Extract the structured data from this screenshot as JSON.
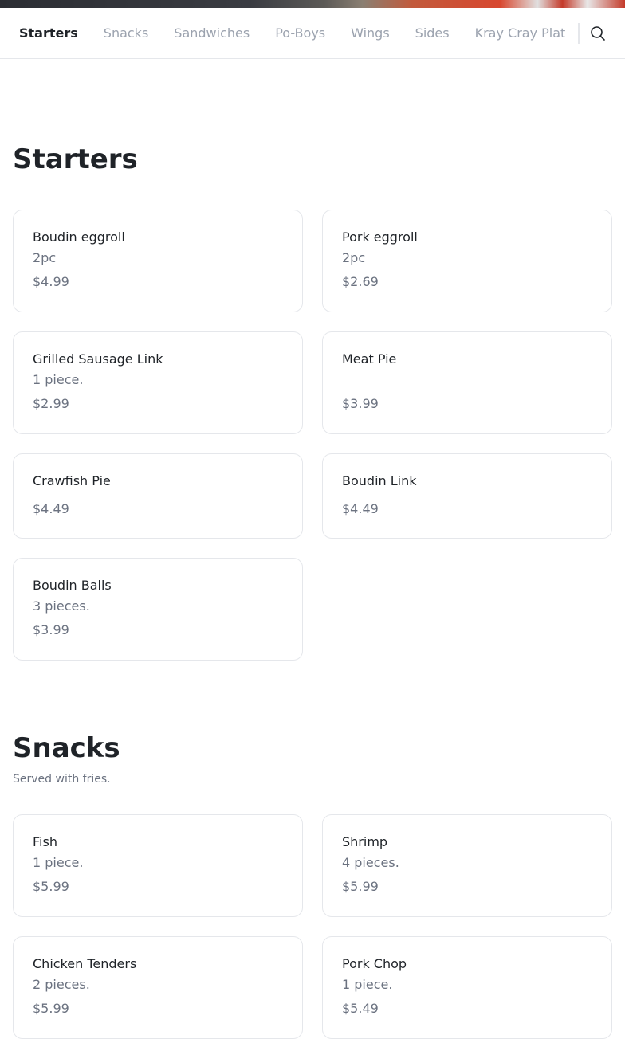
{
  "nav": {
    "tabs": [
      "Starters",
      "Snacks",
      "Sandwiches",
      "Po-Boys",
      "Wings",
      "Sides",
      "Kray Cray Plat"
    ],
    "active": "Starters",
    "search_icon": "search-icon"
  },
  "sections": {
    "starters": {
      "title": "Starters",
      "items": [
        {
          "name": "Boudin eggroll",
          "desc": "2pc",
          "price": "$4.99"
        },
        {
          "name": "Pork eggroll",
          "desc": "2pc",
          "price": "$2.69"
        },
        {
          "name": "Grilled Sausage Link",
          "desc": "1 piece.",
          "price": "$2.99"
        },
        {
          "name": "Meat Pie",
          "desc": "",
          "price": "$3.99"
        },
        {
          "name": "Crawfish Pie",
          "price": "$4.49"
        },
        {
          "name": "Boudin Link",
          "price": "$4.49"
        },
        {
          "name": "Boudin Balls",
          "desc": "3 pieces.",
          "price": "$3.99"
        }
      ]
    },
    "snacks": {
      "title": "Snacks",
      "subtitle": "Served with fries.",
      "items": [
        {
          "name": "Fish",
          "desc": "1 piece.",
          "price": "$5.99"
        },
        {
          "name": "Shrimp",
          "desc": "4 pieces.",
          "price": "$5.99"
        },
        {
          "name": "Chicken Tenders",
          "desc": "2 pieces.",
          "price": "$5.99"
        },
        {
          "name": "Pork Chop",
          "desc": "1 piece.",
          "price": "$5.49"
        }
      ]
    }
  }
}
